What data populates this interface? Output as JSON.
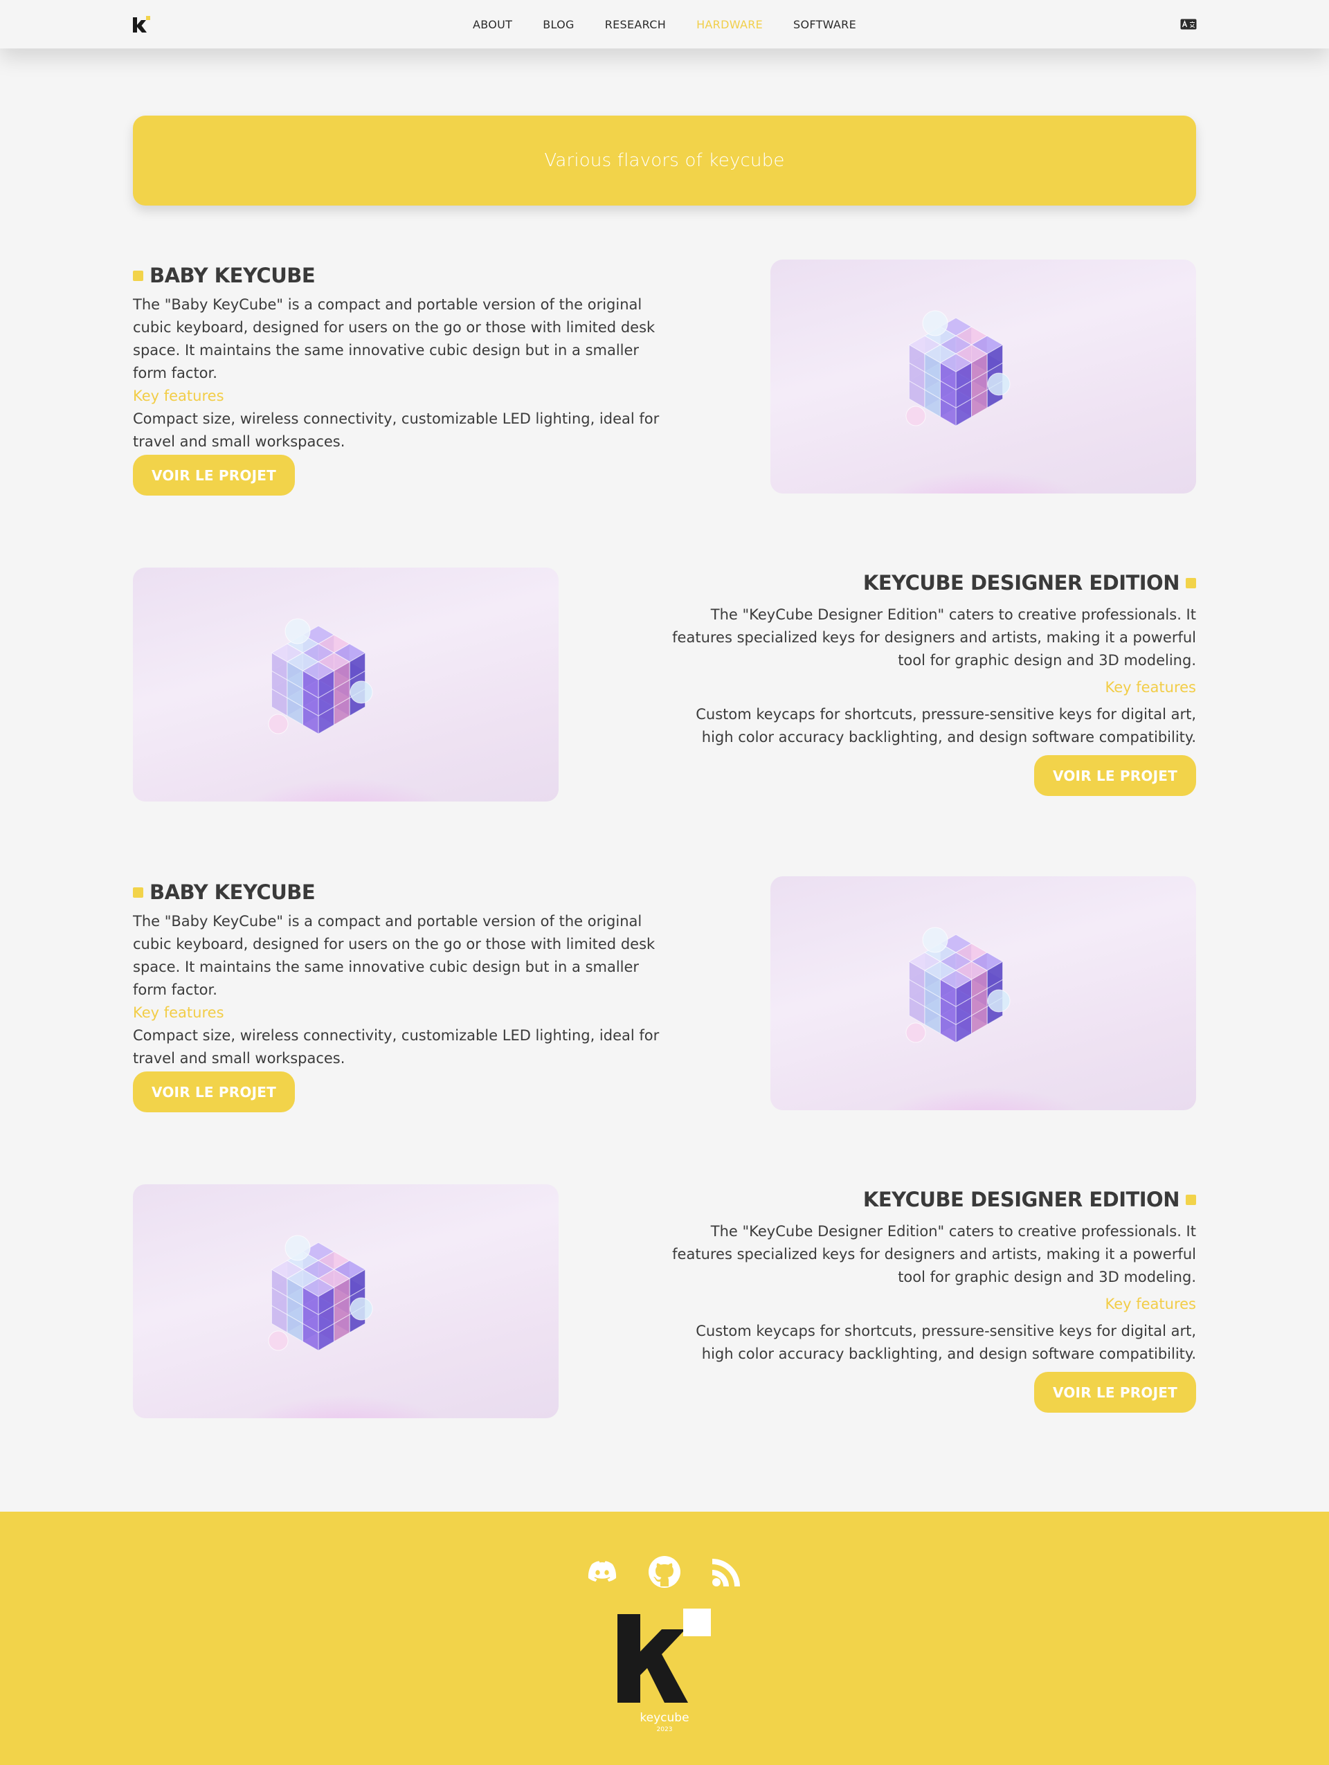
{
  "nav": {
    "logo_icon": "keycube-k-logo-icon",
    "links": [
      {
        "label": "ABOUT",
        "active": false
      },
      {
        "label": "BLOG",
        "active": false
      },
      {
        "label": "RESEARCH",
        "active": false
      },
      {
        "label": "HARDWARE",
        "active": true
      },
      {
        "label": "SOFTWARE",
        "active": false
      }
    ],
    "language_icon": "translate-icon"
  },
  "banner": {
    "title": "Various flavors of keycube"
  },
  "sections": [
    {
      "title": "BABY KEYCUBE",
      "description": "The \"Baby KeyCube\" is a compact and portable version of the original cubic keyboard, designed for users on the go or those with limited desk space. It maintains the same innovative cubic design but in a smaller form factor.",
      "key_features_label": "Key features",
      "key_features": "Compact size, wireless connectivity, customizable LED lighting, ideal for travel and small workspaces.",
      "button_label": "VOIR LE PROJET"
    },
    {
      "title": "KEYCUBE DESIGNER EDITION",
      "description": "The \"KeyCube Designer Edition\" caters to creative professionals. It features specialized keys for designers and artists, making it a powerful tool for graphic design and 3D modeling.",
      "key_features_label": "Key features",
      "key_features": "Custom keycaps for shortcuts, pressure-sensitive keys for digital art, high color accuracy backlighting, and design software compatibility.",
      "button_label": "VOIR LE PROJET"
    },
    {
      "title": "BABY KEYCUBE",
      "description": "The \"Baby KeyCube\" is a compact and portable version of the original cubic keyboard, designed for users on the go or those with limited desk space. It maintains the same innovative cubic design but in a smaller form factor.",
      "key_features_label": "Key features",
      "key_features": "Compact size, wireless connectivity, customizable LED lighting, ideal for travel and small workspaces.",
      "button_label": "VOIR LE PROJET"
    },
    {
      "title": "KEYCUBE DESIGNER EDITION",
      "description": "The \"KeyCube Designer Edition\" caters to creative professionals. It features specialized keys for designers and artists, making it a powerful tool for graphic design and 3D modeling.",
      "key_features_label": "Key features",
      "key_features": "Custom keycaps for shortcuts, pressure-sensitive keys for digital art, high color accuracy backlighting, and design software compatibility.",
      "button_label": "VOIR LE PROJET"
    }
  ],
  "footer": {
    "social_icons": [
      "discord-icon",
      "github-icon",
      "rss-icon"
    ],
    "brand": "keycube",
    "year": "2023"
  },
  "colors": {
    "accent": "#f2d34a",
    "background": "#f5f5f5",
    "text": "#3a3a3a",
    "white": "#ffffff"
  }
}
